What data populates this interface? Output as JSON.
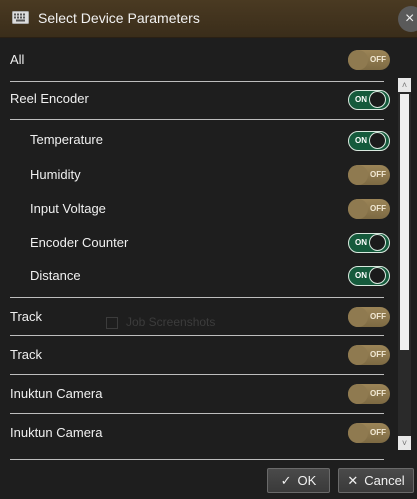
{
  "dialog": {
    "title": "Select Device Parameters",
    "close_glyph": "×"
  },
  "rows": [
    {
      "label": "All",
      "state": "OFF"
    },
    {
      "label": "Reel Encoder",
      "state": "ON"
    },
    {
      "label": "Temperature",
      "state": "ON"
    },
    {
      "label": "Humidity",
      "state": "OFF"
    },
    {
      "label": "Input Voltage",
      "state": "OFF"
    },
    {
      "label": "Encoder Counter",
      "state": "ON"
    },
    {
      "label": "Distance",
      "state": "ON"
    },
    {
      "label": "Track",
      "state": "OFF"
    },
    {
      "label": "Track",
      "state": "OFF"
    },
    {
      "label": "Inuktun Camera",
      "state": "OFF"
    },
    {
      "label": "Inuktun Camera",
      "state": "OFF"
    }
  ],
  "background": {
    "ghost_label": "Job Screenshots"
  },
  "footer": {
    "ok_label": "OK",
    "cancel_label": "Cancel"
  },
  "colors": {
    "title_bar": "#3a2d1a",
    "toggle_on": "#155a3c",
    "toggle_off": "#8f7a50"
  }
}
